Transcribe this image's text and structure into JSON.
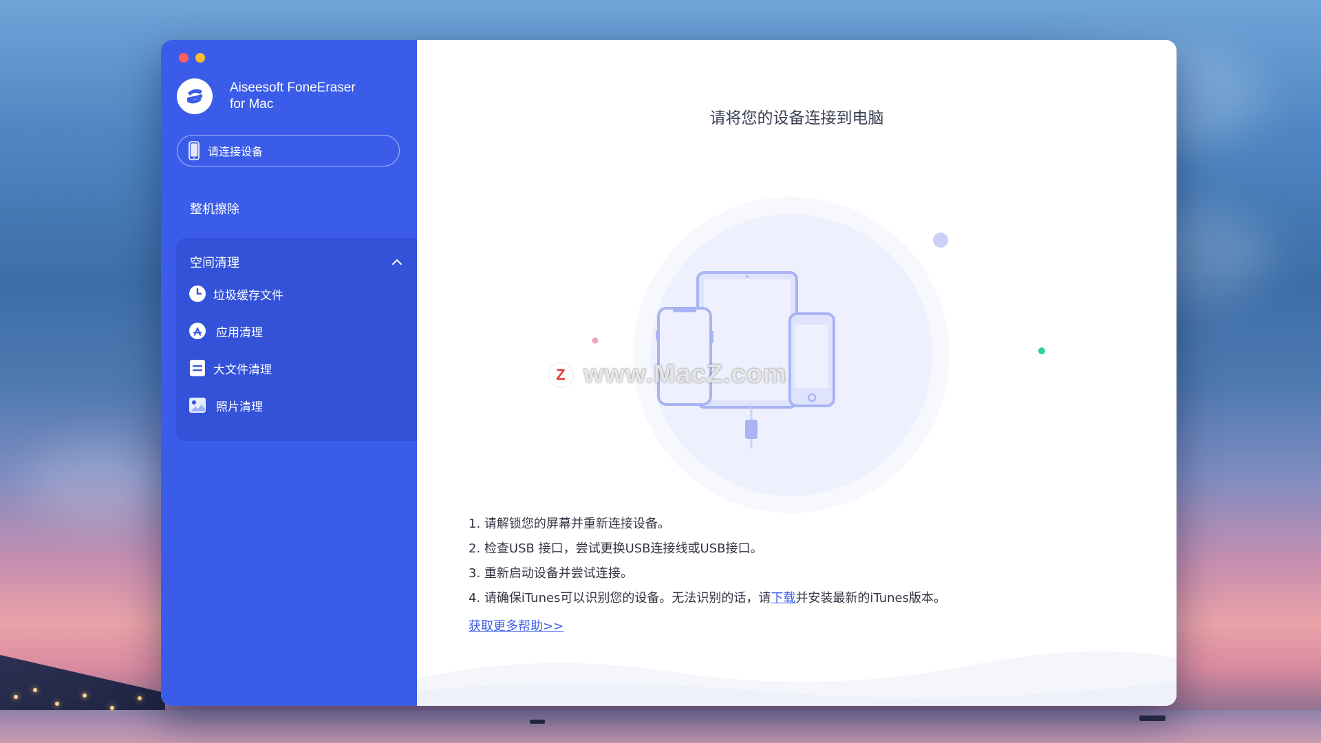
{
  "app": {
    "name_line1": "Aiseesoft FoneEraser",
    "name_line2": "for Mac"
  },
  "sidebar": {
    "device_button_label": "请连接设备",
    "erase_all_label": "整机擦除",
    "space_section": {
      "title": "空间清理",
      "expanded": true,
      "items": [
        {
          "label": "垃圾缓存文件",
          "icon": "clock-icon"
        },
        {
          "label": "应用清理",
          "icon": "app-store-icon"
        },
        {
          "label": "大文件清理",
          "icon": "document-icon"
        },
        {
          "label": "照片清理",
          "icon": "photo-icon"
        }
      ]
    }
  },
  "main": {
    "title": "请将您的设备连接到电脑",
    "watermark": "www.MacZ.com",
    "watermark_logo": "Z",
    "steps": {
      "s1": "1. 请解锁您的屏幕并重新连接设备。",
      "s2": "2. 检查USB 接口，尝试更换USB连接线或USB接口。",
      "s3": "3. 重新启动设备并尝试连接。",
      "s4_before": "4. 请确保iTunes可以识别您的设备。无法识别的话，请",
      "s4_link": "下载",
      "s4_after": "并安装最新的iTunes版本。"
    },
    "help_link": "获取更多帮助>>"
  },
  "colors": {
    "sidebar": "#3b5ce8",
    "sidebar_panel": "#3352d8",
    "link": "#3b5ce8",
    "illustration": "#a9b4f4"
  }
}
